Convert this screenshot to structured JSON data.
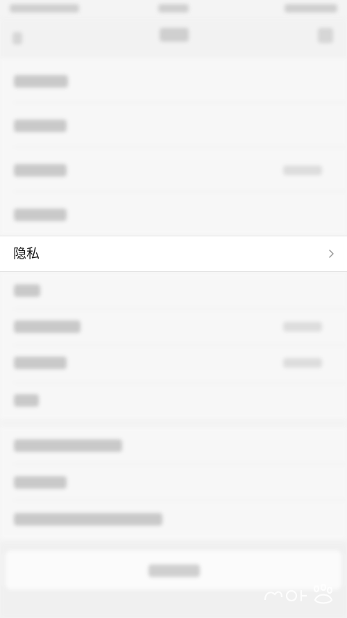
{
  "settings": {
    "privacy_label": "隐私"
  },
  "icons": {
    "chevron": "chevron-right-icon",
    "watermark": "baidu-jingyan-logo"
  },
  "colors": {
    "background": "#f4f4f4",
    "row_highlight": "#ffffff",
    "text": "#1a1a1a",
    "chevron": "#9a9a9a"
  }
}
